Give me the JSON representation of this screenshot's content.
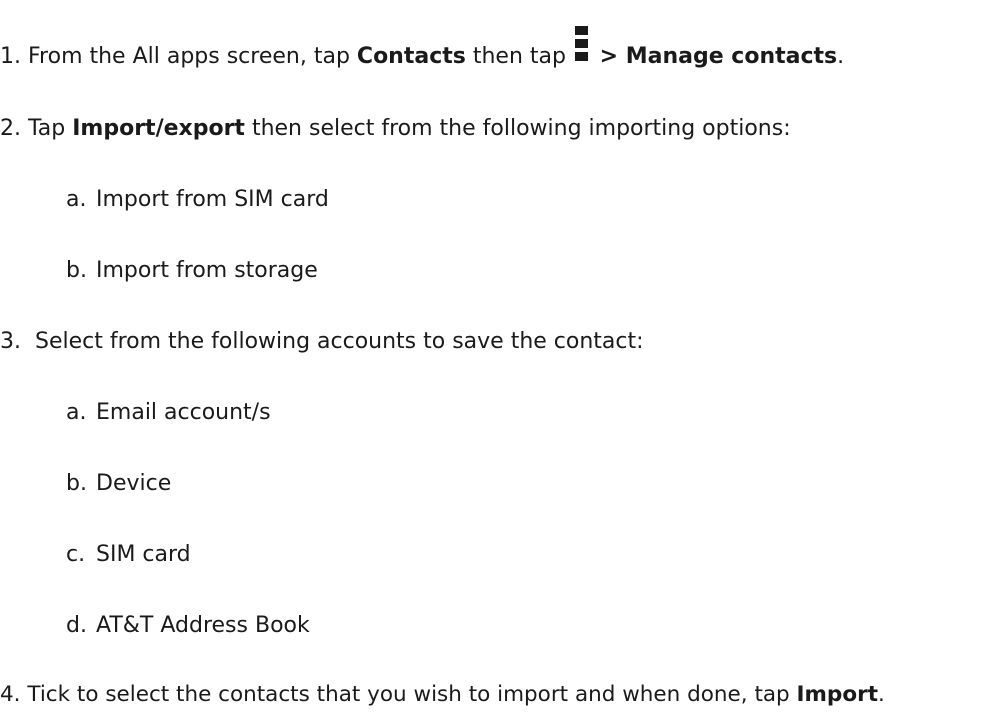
{
  "steps": [
    {
      "num": "1.",
      "text_a": " From the All apps screen, tap ",
      "bold_a": "Contacts",
      "text_b": " then tap ",
      "icon": "overflow-menu-icon",
      "bold_b": " > Manage contacts",
      "text_c": "."
    },
    {
      "num": "2.",
      "text_a": " Tap ",
      "bold_a": "Import/export",
      "text_b": " then select from the following importing options:",
      "options": [
        {
          "letter": "a.",
          "label": "Import from SIM card"
        },
        {
          "letter": "b.",
          "label": "Import from storage"
        }
      ]
    },
    {
      "num": "3.",
      "text_a": "  Select from the following accounts to save the contact:",
      "options": [
        {
          "letter": "a.",
          "label": "Email account/s"
        },
        {
          "letter": "b.",
          "label": "Device"
        },
        {
          "letter": "c.",
          "label": "SIM card"
        },
        {
          "letter": "d.",
          "label": "AT&T Address Book"
        }
      ]
    },
    {
      "num": "4.",
      "text_a": " Tick to select the contacts that you wish to import and when done, tap ",
      "bold_a": "Import",
      "text_b": "."
    }
  ]
}
